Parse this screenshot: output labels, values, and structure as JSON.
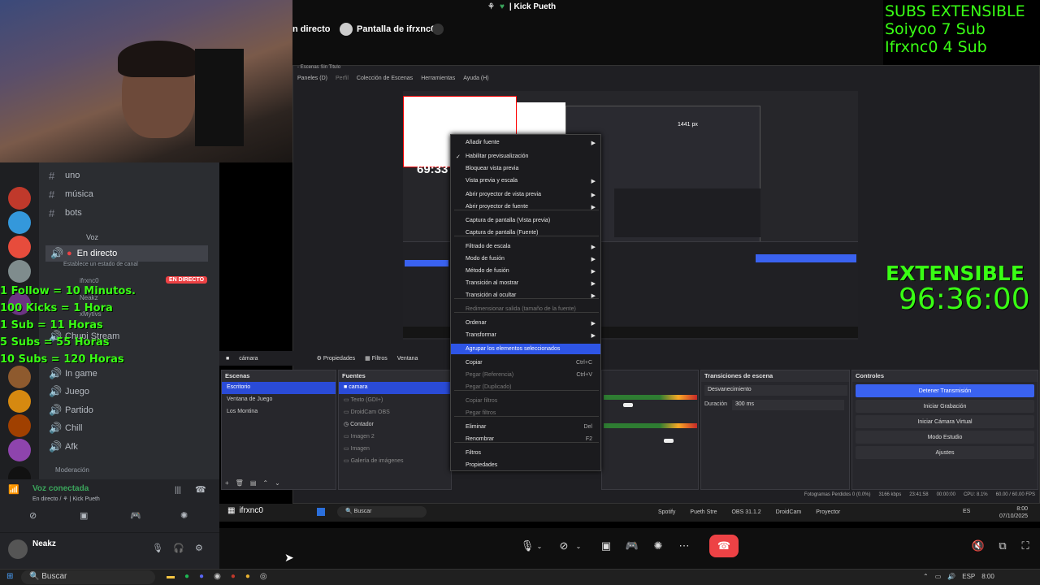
{
  "stream_header": {
    "title": "| Kick Pueth",
    "live_label": "n directo",
    "screen_label": "Pantalla de ifrxnc0"
  },
  "subs_overlay": {
    "title": "SUBS EXTENSIBLE",
    "line1": "Soiyoo 7 Sub",
    "line2": "Ifrxnc0 4 Sub"
  },
  "extensible": {
    "label": "EXTENSIBLE",
    "timer": "96:36:00"
  },
  "preview_timer": "69:33",
  "preview_px": "1441 px",
  "rules": [
    "1 Follow = 10 Minutos.",
    "100 Kicks = 1 Hora",
    "1 Sub = 11 Horas",
    "5 Subs = 55 Horas",
    "10 Subs = 120 Horas"
  ],
  "obs": {
    "title": "- Escenas Sin Titulo",
    "menu": [
      "Paneles (D)",
      "Perfil",
      "Colección de Escenas",
      "Herramientas",
      "Ayuda (H)"
    ],
    "source_bar": {
      "source": "cámara",
      "properties": "Propiedades",
      "filters": "Filtros",
      "window": "Ventana"
    },
    "scenes_title": "Escenas",
    "scenes": [
      "Escritorio",
      "Ventana de Juego",
      "Los Montina"
    ],
    "sources_title": "Fuentes",
    "sources": [
      "camara",
      "Texto (GDI+)",
      "DroidCam OBS",
      "Contador",
      "Imagen 2",
      "Imagen",
      "Galería de imágenes"
    ],
    "transitions_title": "Transiciones de escena",
    "transition": "Desvanecimiento",
    "duration_label": "Duración",
    "duration_value": "300 ms",
    "controls_title": "Controles",
    "controls": [
      "Detener Transmisión",
      "Iniciar Grabación",
      "Iniciar Cámara Virtual",
      "Modo Estudio",
      "Ajustes"
    ],
    "status": {
      "dropped": "Fotogramas Perdidos 0 (0.0%)",
      "kbps": "3166 kbps",
      "time": "23:41:58",
      "rec": "00:00:00",
      "cpu": "CPU: 8.1%",
      "fps": "60.00 / 60.00 FPS"
    }
  },
  "context_menu": {
    "items": [
      {
        "label": "Añadir fuente",
        "arrow": "▶"
      },
      {
        "label": "Habilitar previsualización",
        "check": "✓"
      },
      {
        "label": "Bloquear vista previa"
      },
      {
        "label": "Vista previa y escala",
        "arrow": "▶"
      },
      {
        "label": "Abrir proyector de vista previa",
        "arrow": "▶"
      },
      {
        "label": "Abrir proyector de fuente",
        "arrow": "▶"
      },
      {
        "label": "Captura de pantalla (Vista previa)"
      },
      {
        "label": "Captura de pantalla (Fuente)"
      },
      {
        "label": "Filtrado de escala",
        "arrow": "▶"
      },
      {
        "label": "Modo de fusión",
        "arrow": "▶"
      },
      {
        "label": "Método de fusión",
        "arrow": "▶"
      },
      {
        "label": "Transición al mostrar",
        "arrow": "▶"
      },
      {
        "label": "Transición al ocultar",
        "arrow": "▶"
      },
      {
        "label": "Redimensionar salida (tamaño de la fuente)",
        "disabled": true
      },
      {
        "label": "Ordenar",
        "arrow": "▶"
      },
      {
        "label": "Transformar",
        "arrow": "▶"
      },
      {
        "label": "Agrupar los elementos seleccionados",
        "highlight": true
      },
      {
        "label": "Copiar",
        "shortcut": "Ctrl+C"
      },
      {
        "label": "Pegar (Referencia)",
        "shortcut": "Ctrl+V",
        "disabled": true
      },
      {
        "label": "Pegar (Duplicado)",
        "disabled": true
      },
      {
        "label": "Copiar filtros",
        "disabled": true
      },
      {
        "label": "Pegar filtros",
        "disabled": true
      },
      {
        "label": "Eliminar",
        "shortcut": "Del"
      },
      {
        "label": "Renombrar",
        "shortcut": "F2"
      },
      {
        "label": "Filtros"
      },
      {
        "label": "Propiedades"
      }
    ]
  },
  "discord": {
    "channels": [
      {
        "label": "uno"
      },
      {
        "label": "música"
      },
      {
        "label": "bots"
      }
    ],
    "voice_category": "Voz",
    "live_channel": "En directo",
    "live_status": "Establece un estado de canal",
    "live_badge": "EN DIRECTO",
    "member1": "ifrxnc0",
    "member2": "Neakz",
    "member3": "xMytivs",
    "voice_channels": [
      {
        "label": "Chupi Stream"
      },
      {
        "label": "In game"
      },
      {
        "label": "Juego"
      },
      {
        "label": "Partido"
      },
      {
        "label": "Chill"
      },
      {
        "label": "Afk"
      }
    ],
    "moderation": "Moderación",
    "voice_connected": "Voz conectada",
    "voice_channel_path": "En directo / ⚘ | Kick Pueth",
    "user": "Neakz"
  },
  "stream_taskbar": {
    "search": "Buscar",
    "app": "ifrxnc0",
    "spotify": "Spotify",
    "pueth": "Pueth Stre",
    "obs": "OBS 31.1.2",
    "droidcam": "DroidCam",
    "projector": "Proyector",
    "lang": "ES",
    "time": "8:00",
    "date": "07/10/2025"
  },
  "win_taskbar": {
    "search": "Buscar",
    "lang": "ESP",
    "time": "8:00"
  },
  "colors": {
    "accent": "#2e55e6",
    "green": "#39ff14",
    "live_red": "#ed4245"
  }
}
